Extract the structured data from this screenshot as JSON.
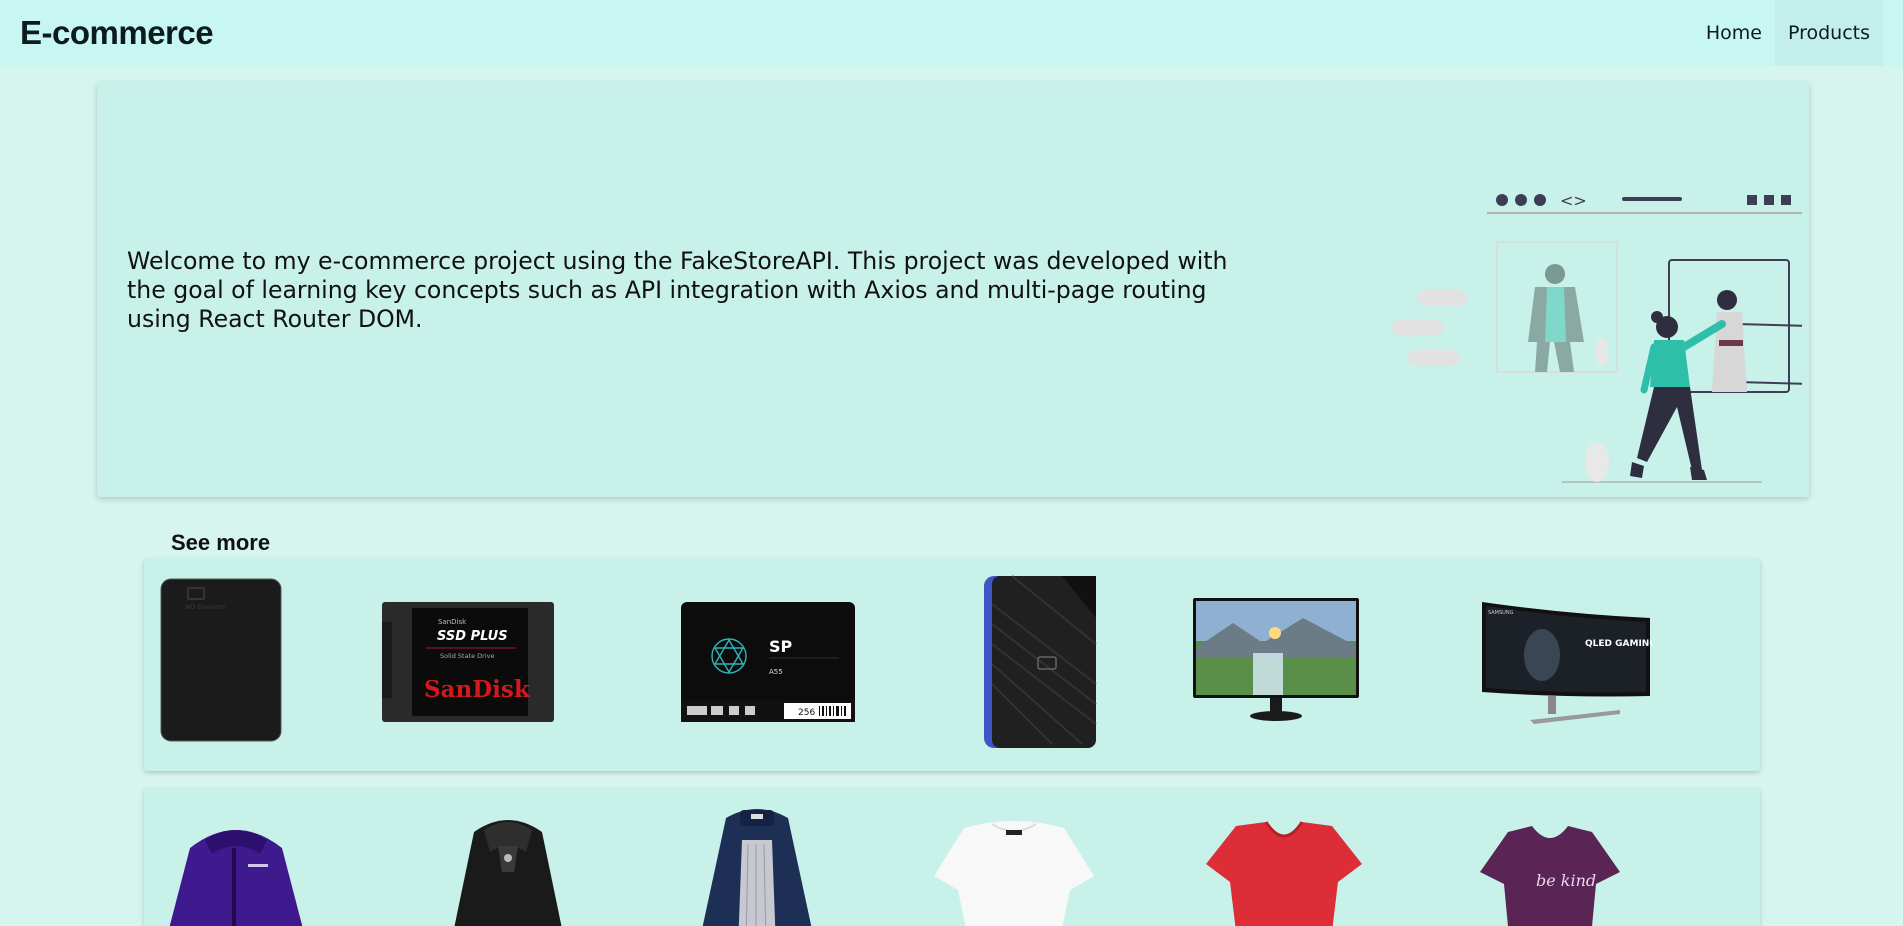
{
  "navbar": {
    "brand": "E-commerce",
    "links": [
      {
        "label": "Home"
      },
      {
        "label": "Products"
      }
    ]
  },
  "hero": {
    "text": "Welcome to my e-commerce project using the FakeStoreAPI. This project was developed with the goal of learning key concepts such as API integration with Axios and multi-page routing using React Router DOM.",
    "illustration": "woman-browsing-online-store-illustration",
    "accent_color": "#2ebfaa"
  },
  "see_more": {
    "title": "See more",
    "rows": [
      {
        "items": [
          {
            "icon": "black-external-hard-drive",
            "label": "WD Elements"
          },
          {
            "icon": "sandisk-ssd",
            "brand_text": "SanDisk",
            "model_text": "SSD PLUS",
            "sub_text": "Solid State Drive",
            "logo_text": "SanDisk"
          },
          {
            "icon": "silicon-power-ssd",
            "logo_text": "SP",
            "model_text": "A55",
            "capacity_text": "256"
          },
          {
            "icon": "wd-gaming-drive"
          },
          {
            "icon": "monitor"
          },
          {
            "icon": "curved-gaming-monitor",
            "brand_text": "SAMSUNG",
            "screen_text": "QLED GAMING MONITOR"
          }
        ]
      },
      {
        "items": [
          {
            "icon": "purple-jacket"
          },
          {
            "icon": "black-leather-jacket"
          },
          {
            "icon": "navy-raincoat"
          },
          {
            "icon": "white-top"
          },
          {
            "icon": "red-tshirt"
          },
          {
            "icon": "purple-tshirt",
            "print_text": "be kind"
          }
        ]
      }
    ]
  },
  "colors": {
    "navbar_bg": "#c8f7f1",
    "page_bg": "#d6f5ee",
    "card_bg": "#c8f2e9"
  }
}
